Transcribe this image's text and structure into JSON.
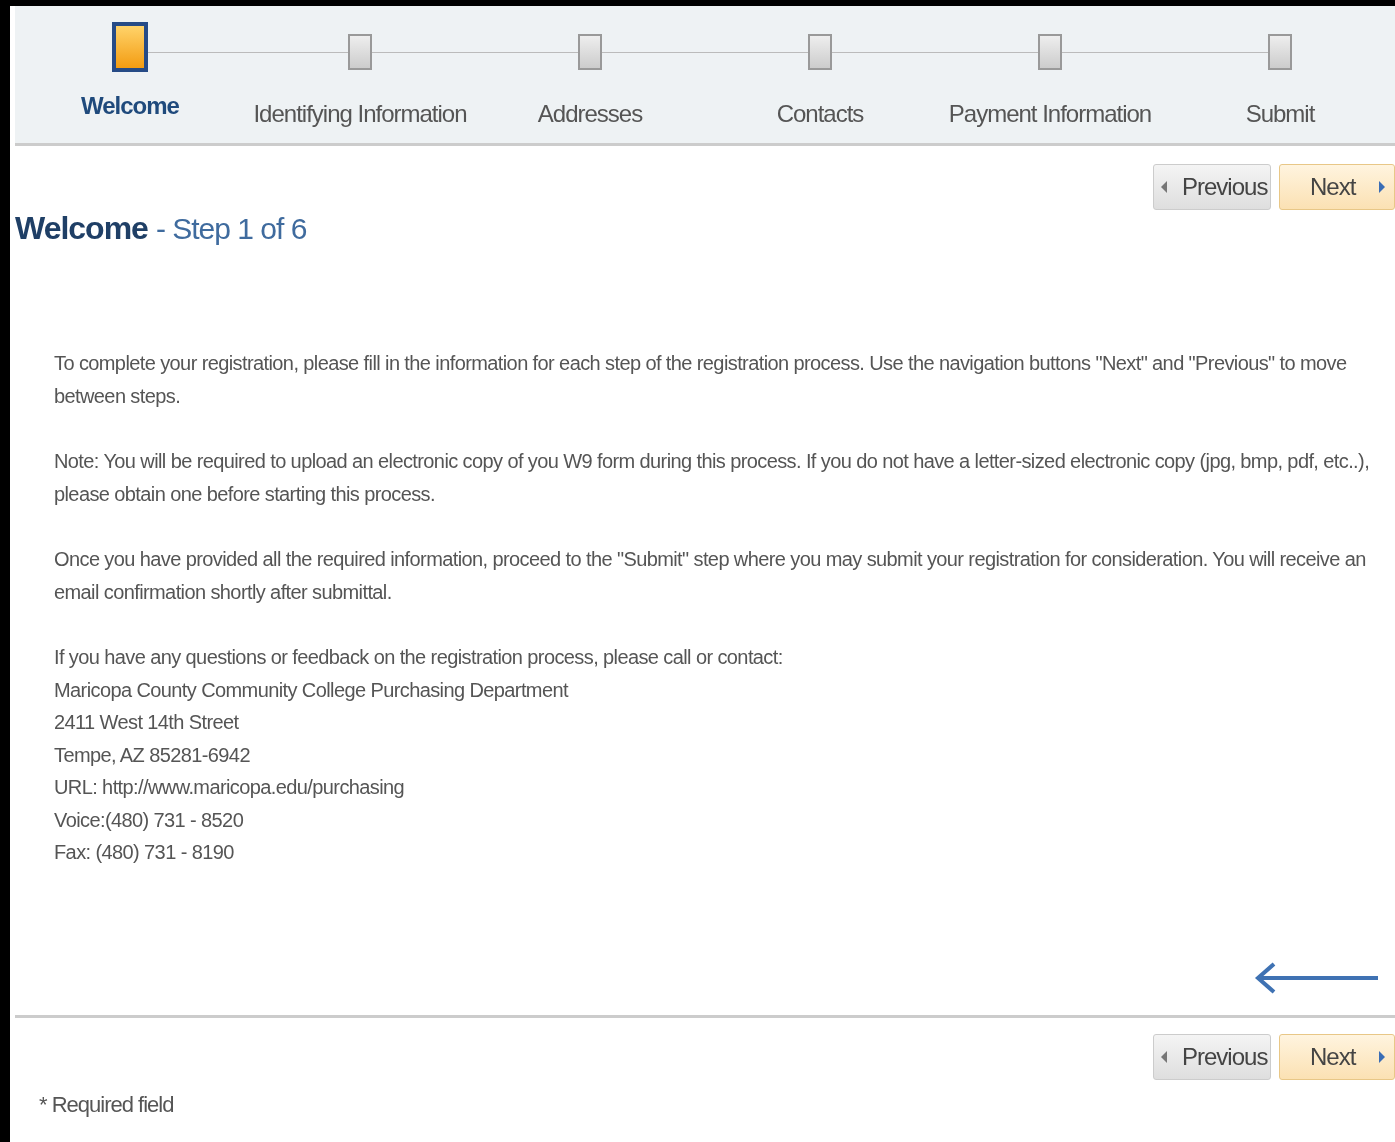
{
  "steps": [
    {
      "label": "Welcome",
      "selected": true
    },
    {
      "label": "Identifying Information",
      "selected": false
    },
    {
      "label": "Addresses",
      "selected": false
    },
    {
      "label": "Contacts",
      "selected": false
    },
    {
      "label": "Payment Information",
      "selected": false
    },
    {
      "label": "Submit",
      "selected": false
    }
  ],
  "nav_top": {
    "previous": "Previous",
    "next": "Next"
  },
  "heading": {
    "title": "Welcome",
    "subtitle": "- Step 1 of 6"
  },
  "paragraphs": [
    "To complete your registration, please fill in the information for each step of the registration process.  Use the navigation buttons \"Next\" and \"Previous\" to move between steps.",
    "Note:  You will be required to upload an electronic copy of you W9 form during this process.  If you do not have a letter-sized electronic copy (jpg, bmp, pdf, etc..), please obtain one before starting this process.",
    "Once you have provided all the required information, proceed to the \"Submit\" step where you may submit your registration for consideration.  You will receive an email confirmation shortly after submittal."
  ],
  "contact_lines": [
    "If you have any questions or feedback on the registration process, please call or contact:",
    "Maricopa County Community College Purchasing Department",
    "2411 West 14th Street",
    "Tempe, AZ 85281-6942",
    "URL: http://www.maricopa.edu/purchasing",
    "Voice:(480) 731 - 8520",
    "Fax: (480) 731 - 8190"
  ],
  "nav_bottom": {
    "previous": "Previous",
    "next": "Next"
  },
  "footnote": "* Required field"
}
